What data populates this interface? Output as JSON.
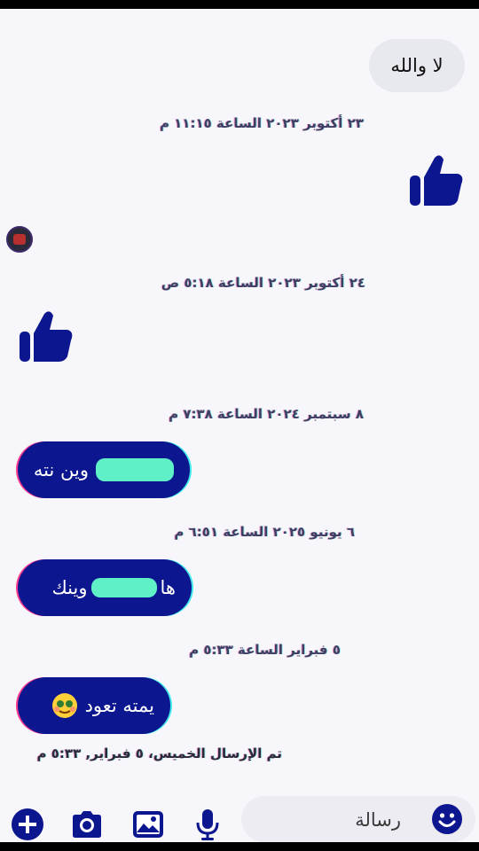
{
  "messages": [
    {
      "text": "لا والله"
    },
    {
      "time": "٢٣ أكتوبر ٢٠٢٣ الساعة ١١:١٥ م"
    },
    {
      "time": "٢٤ أكتوبر ٢٠٢٣ الساعة ٥:١٨ ص"
    },
    {
      "time": "٨ سبتمبر ٢٠٢٤ الساعة ٧:٣٨ م"
    },
    {
      "text": "وين نته"
    },
    {
      "time": "٦ يونيو ٢٠٢٥ الساعة ٦:٥١ م"
    },
    {
      "text_prefix": "ها",
      "text": "وينك"
    },
    {
      "time": "٥ فبراير الساعة ٥:٣٣ م"
    },
    {
      "text": "يمته تعود"
    },
    {
      "status": "تم الإرسال الخميس، ٥ فبراير, ٥:٣٣ م"
    }
  ],
  "composer": {
    "placeholder": "رسالة"
  },
  "colors": {
    "accent": "#0c168f",
    "background": "#f7f7fb",
    "incoming_bubble": "#e8e8ef"
  },
  "icons": [
    "like-icon",
    "add-icon",
    "camera-icon",
    "gallery-icon",
    "mic-icon",
    "emoji-icon"
  ]
}
